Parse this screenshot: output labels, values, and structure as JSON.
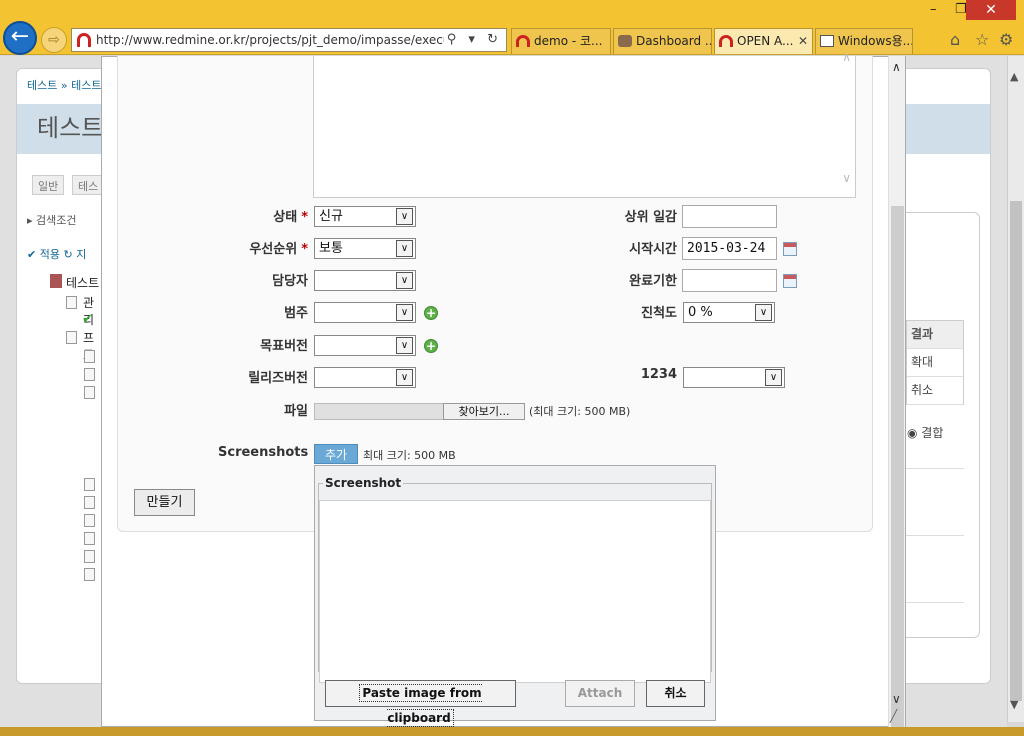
{
  "browser": {
    "url": "http://www.redmine.or.kr/projects/pjt_demo/impasse/executions/i",
    "tabs": [
      {
        "label": "demo - 코...",
        "icon": "redmine-icon",
        "active": false
      },
      {
        "label": "Dashboard ...",
        "icon": "jenkins-icon",
        "active": false
      },
      {
        "label": "OPEN A...",
        "icon": "redmine-icon",
        "active": true
      },
      {
        "label": "Windows용...",
        "icon": "java-icon",
        "active": false
      }
    ],
    "address_controls": "⚲ ▾ ↻"
  },
  "background_page": {
    "breadcrumb": "테스트 » 테스트",
    "title": "테스트",
    "tabs": [
      "일반",
      "테스"
    ],
    "filter_label": "검색조건",
    "apply_label": "적용",
    "apply_extra": "지",
    "tree_labels": [
      "테스트",
      "관리",
      "프로"
    ],
    "right_table": {
      "header": "결과",
      "rows": [
        "확대",
        "취소"
      ]
    },
    "radio_label": "결합"
  },
  "form": {
    "status": {
      "label": "상태",
      "value": "신규"
    },
    "priority": {
      "label": "우선순위",
      "value": "보통"
    },
    "assignee": {
      "label": "담당자",
      "value": ""
    },
    "category": {
      "label": "범주",
      "value": ""
    },
    "target_version": {
      "label": "목표버전",
      "value": ""
    },
    "release_version": {
      "label": "릴리즈버전",
      "value": ""
    },
    "parent_task": {
      "label": "상위 일감",
      "value": ""
    },
    "start_date": {
      "label": "시작시간",
      "value": "2015-03-24"
    },
    "due_date": {
      "label": "완료기한",
      "value": ""
    },
    "done_ratio": {
      "label": "진척도",
      "value": "0 %"
    },
    "custom_1234": {
      "label": "1234",
      "value": ""
    },
    "file": {
      "label": "파일",
      "browse_label": "찾아보기...",
      "max_size": "(최대 크기: 500 MB)"
    },
    "screenshots": {
      "label": "Screenshots",
      "add_label": "추가",
      "max_size": "최대 크기: 500 MB"
    },
    "create_label": "만들기"
  },
  "screenshot_popup": {
    "legend": "Screenshot",
    "paste_label": "Paste image from clipboard",
    "attach_label": "Attach",
    "cancel_label": "취소"
  },
  "colors": {
    "chrome": "#f3c331",
    "required": "#bb0000",
    "add_button": "#6aa9d6"
  }
}
